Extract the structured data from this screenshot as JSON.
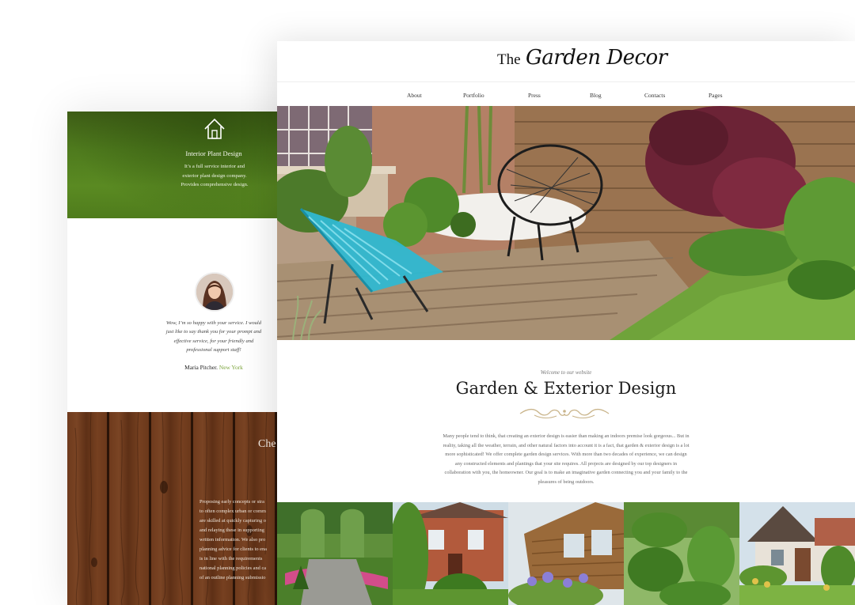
{
  "back": {
    "service": {
      "icon": "house-icon",
      "title": "Interior Plant Design",
      "line1": "It’s a full service interior and",
      "line2": "exterior plant design company.",
      "line3": "Provides comprehensive design."
    },
    "testimonial": {
      "line1": "Wow, I’m so happy with your service. I would",
      "line2": "just like to say thank you for your prompt and",
      "line3": "effective service, for your friendly and",
      "line4": "professional support staff!",
      "author": "Maria Pitcher.",
      "city": "New York"
    },
    "wood_section": {
      "heading": "Che",
      "lines": [
        "Proposing early concepts or stra",
        "to often complex urban or comm",
        "are skilled at quickly capturing o",
        "and relaying these in supporting",
        "written information. We also pro",
        "planning advice for clients to ena",
        "is in line with the requirements",
        "national planning policies and ca",
        "of an outline planning submissio"
      ]
    }
  },
  "front": {
    "logo_the": "The",
    "logo_name": "Garden Decor",
    "nav": [
      "About",
      "Portfolio",
      "Press",
      "Blog",
      "Contacts",
      "Pages"
    ],
    "welcome": "Welcome to our website",
    "title": "Garden & Exterior Design",
    "intro": [
      "Many people tend to think, that creating an exterior design is easier than making an indoors premise look gorgeous... But in",
      "reality, taking all the weather, terrain, and other natural factors into account it is a fact, that garden & exterior design is a lot",
      "more sophisticated! We offer complete garden design services. With more than two decades of experience, we can design",
      "any constructed elements and plantings that your site requires. All projects are designed by our top designers in",
      "collaboration with you, the homeowner. Our goal is to make an imaginative garden connecting you and your family to the",
      "pleasures of being outdoors."
    ]
  },
  "colors": {
    "accent_green": "#7aa33a",
    "ornament": "#c9b48a",
    "chair_blue": "#2fb8d1"
  }
}
